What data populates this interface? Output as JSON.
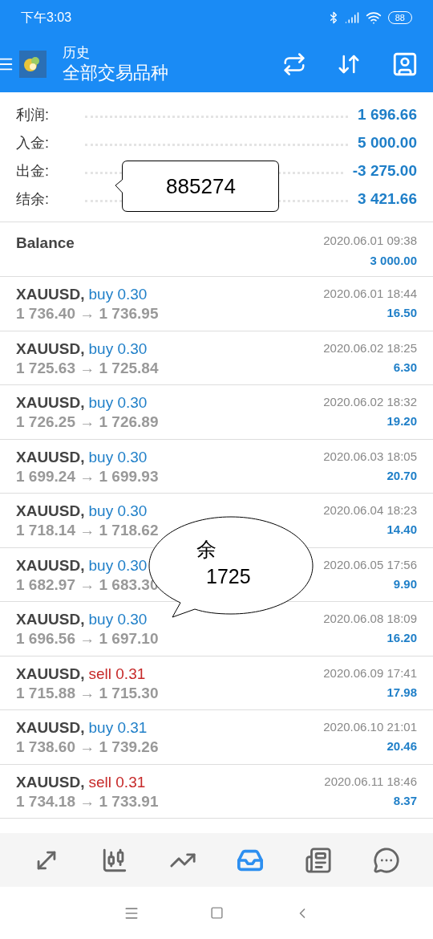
{
  "status_bar": {
    "time": "下午3:03",
    "battery": "88"
  },
  "header": {
    "subtitle": "历史",
    "title": "全部交易品种"
  },
  "summary": [
    {
      "label": "利润:",
      "value": "1 696.66"
    },
    {
      "label": "入金:",
      "value": "5 000.00"
    },
    {
      "label": "出金:",
      "value": "-3 275.00"
    },
    {
      "label": "结余:",
      "value": "3 421.66"
    }
  ],
  "balance": {
    "label": "Balance",
    "time": "2020.06.01 09:38",
    "amount": "3 000.00"
  },
  "trades": [
    {
      "symbol": "XAUUSD,",
      "kind": "buy",
      "deal": "buy 0.30",
      "prices": "1 736.40 → 1 736.95",
      "time": "2020.06.01 18:44",
      "profit": "16.50"
    },
    {
      "symbol": "XAUUSD,",
      "kind": "buy",
      "deal": "buy 0.30",
      "prices": "1 725.63 → 1 725.84",
      "time": "2020.06.02 18:25",
      "profit": "6.30"
    },
    {
      "symbol": "XAUUSD,",
      "kind": "buy",
      "deal": "buy 0.30",
      "prices": "1 726.25 → 1 726.89",
      "time": "2020.06.02 18:32",
      "profit": "19.20"
    },
    {
      "symbol": "XAUUSD,",
      "kind": "buy",
      "deal": "buy 0.30",
      "prices": "1 699.24 → 1 699.93",
      "time": "2020.06.03 18:05",
      "profit": "20.70"
    },
    {
      "symbol": "XAUUSD,",
      "kind": "buy",
      "deal": "buy 0.30",
      "prices": "1 718.14 → 1 718.62",
      "time": "2020.06.04 18:23",
      "profit": "14.40"
    },
    {
      "symbol": "XAUUSD,",
      "kind": "buy",
      "deal": "buy 0.30",
      "prices": "1 682.97 → 1 683.30",
      "time": "2020.06.05 17:56",
      "profit": "9.90"
    },
    {
      "symbol": "XAUUSD,",
      "kind": "buy",
      "deal": "buy 0.30",
      "prices": "1 696.56 → 1 697.10",
      "time": "2020.06.08 18:09",
      "profit": "16.20"
    },
    {
      "symbol": "XAUUSD,",
      "kind": "sell",
      "deal": "sell 0.31",
      "prices": "1 715.88 → 1 715.30",
      "time": "2020.06.09 17:41",
      "profit": "17.98"
    },
    {
      "symbol": "XAUUSD,",
      "kind": "buy",
      "deal": "buy 0.31",
      "prices": "1 738.60 → 1 739.26",
      "time": "2020.06.10 21:01",
      "profit": "20.46"
    },
    {
      "symbol": "XAUUSD,",
      "kind": "sell",
      "deal": "sell 0.31",
      "prices": "1 734.18 → 1 733.91",
      "time": "2020.06.11 18:46",
      "profit": "8.37"
    }
  ],
  "callouts": [
    {
      "kind": "box",
      "lines": [
        "885274"
      ]
    },
    {
      "kind": "oval",
      "lines": [
        "余",
        "1725"
      ]
    }
  ],
  "bottom_nav": [
    {
      "kind": "trade",
      "selected": false
    },
    {
      "kind": "quotes",
      "selected": false
    },
    {
      "kind": "chart",
      "selected": false
    },
    {
      "kind": "history",
      "selected": true
    },
    {
      "kind": "news",
      "selected": false
    },
    {
      "kind": "chat",
      "selected": false
    }
  ]
}
